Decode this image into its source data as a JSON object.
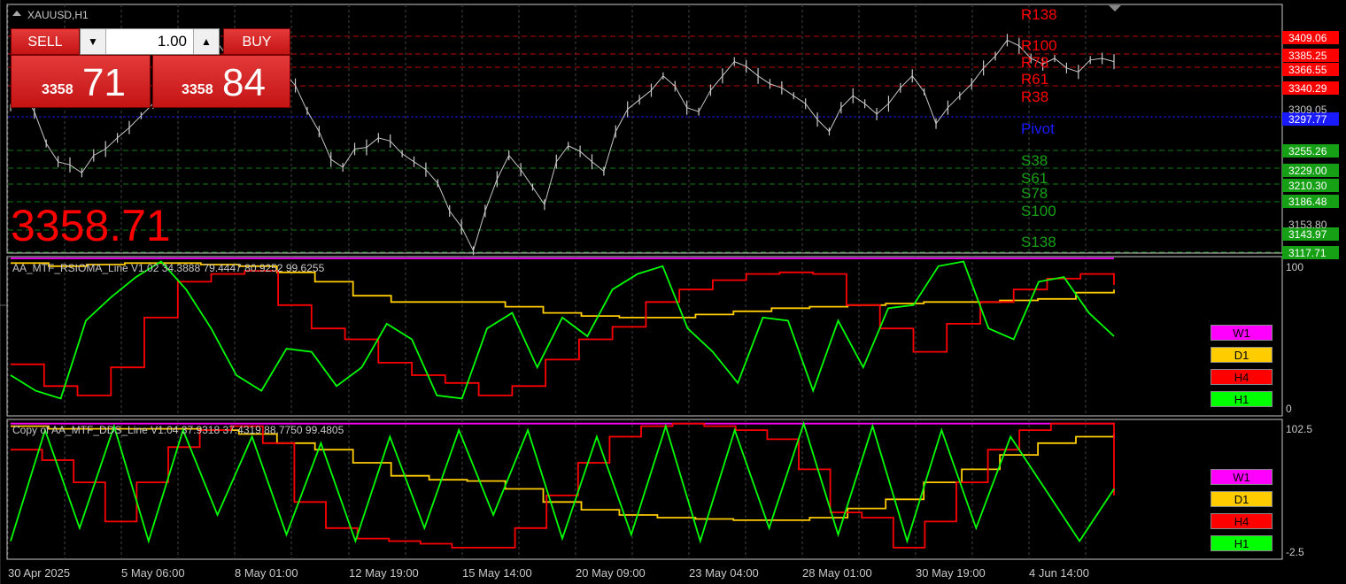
{
  "symbol_title": "XAUUSD,H1",
  "trade_panel": {
    "sell_label": "SELL",
    "buy_label": "BUY",
    "lot_value": "1.00",
    "sell_big": "3358",
    "sell_small": "71",
    "buy_big": "3358",
    "buy_small": "84"
  },
  "current_price": "3358.71",
  "indicator1_label": "AA_MTF_RSIOMA_Line V1.02 34.3888 79.4447 80.9252 99.6255",
  "indicator2_label": "Copy of AA_MTF_DDS_Line V1.04 37.9318 37.4319 88.7750 99.4805",
  "main_axis_labels": [
    "3309.05",
    "3153.80"
  ],
  "ind1_axis_labels": [
    "100",
    "0"
  ],
  "ind2_axis_labels": [
    "102.5",
    "-2.5"
  ],
  "time_labels": [
    "30 Apr 2025",
    "5 May 06:00",
    "8 May 01:00",
    "12 May 19:00",
    "15 May 14:00",
    "20 May 09:00",
    "23 May 04:00",
    "28 May 01:00",
    "30 May 19:00",
    "4 Jun 14:00"
  ],
  "pivot_levels": [
    {
      "name": "R138",
      "value": "",
      "color": "#ff0000"
    },
    {
      "name": "R100",
      "value": "3409.06",
      "color": "#ff0000"
    },
    {
      "name": "R78",
      "value": "3385.25",
      "color": "#ff0000"
    },
    {
      "name": "R61",
      "value": "3366.55",
      "color": "#ff0000"
    },
    {
      "name": "R38",
      "value": "3340.29",
      "color": "#ff0000"
    },
    {
      "name": "Pivot",
      "value": "3297.77",
      "color": "#1a1aff"
    },
    {
      "name": "S38",
      "value": "3255.26",
      "color": "#16a016"
    },
    {
      "name": "S61",
      "value": "3229.00",
      "color": "#16a016"
    },
    {
      "name": "S78",
      "value": "3210.30",
      "color": "#16a016"
    },
    {
      "name": "S100",
      "value": "3186.48",
      "color": "#16a016"
    },
    {
      "name": "S138",
      "value": "3143.97",
      "color": "#16a016"
    },
    {
      "name": "",
      "value": "3117.71",
      "color": "#16a016"
    }
  ],
  "timeframe_buttons": [
    {
      "label": "W1",
      "color": "#ff00ff"
    },
    {
      "label": "D1",
      "color": "#ffcc00"
    },
    {
      "label": "H4",
      "color": "#ff0000"
    },
    {
      "label": "H1",
      "color": "#00ff00"
    }
  ],
  "chart_data": [
    {
      "type": "line",
      "title": "XAUUSD,H1",
      "series": [
        {
          "values": [
            3300,
            3320,
            3295,
            3255,
            3232,
            3228,
            3218,
            3240,
            3248,
            3262,
            3275,
            3290,
            3305,
            3330,
            3358,
            3370,
            3375,
            3390,
            3370,
            3345,
            3325,
            3318,
            3310,
            3345,
            3328,
            3296,
            3270,
            3235,
            3225,
            3248,
            3250,
            3262,
            3258,
            3242,
            3232,
            3222,
            3205,
            3170,
            3150,
            3120,
            3170,
            3210,
            3240,
            3222,
            3200,
            3178,
            3232,
            3252,
            3245,
            3232,
            3220,
            3270,
            3298,
            3310,
            3322,
            3340,
            3327,
            3300,
            3295,
            3322,
            3340,
            3358,
            3352,
            3340,
            3330,
            3325,
            3315,
            3305,
            3285,
            3270,
            3300,
            3315,
            3305,
            3292,
            3305,
            3325,
            3340,
            3320,
            3280,
            3300,
            3315,
            3330,
            3350,
            3365,
            3385,
            3378,
            3362,
            3355,
            3362,
            3350,
            3345,
            3360,
            3362,
            3358
          ]
        }
      ],
      "ylim": [
        3117,
        3430
      ]
    },
    {
      "type": "line",
      "title": "AA_MTF_RSIOMA_Line V1.02 34.3888 79.4447 80.9252 99.6255",
      "ylim": [
        0,
        100
      ],
      "series": [
        {
          "name": "W1",
          "color": "#ff00ff",
          "values": [
            100,
            100,
            100,
            100,
            100,
            100,
            100,
            100,
            100,
            100,
            100,
            100,
            100,
            100,
            100,
            100,
            100,
            100,
            100,
            100,
            100,
            100,
            100,
            100,
            100,
            100,
            100,
            100,
            100,
            100
          ]
        },
        {
          "name": "D1",
          "color": "#ffcc00",
          "values": [
            97,
            95,
            96,
            97,
            97,
            96,
            95,
            91,
            85,
            76,
            72,
            72,
            72,
            69,
            65,
            63,
            62,
            62,
            64,
            66,
            68,
            69,
            70,
            71,
            72,
            72,
            73,
            74,
            78,
            80
          ]
        },
        {
          "name": "H4",
          "color": "#ff0000",
          "values": [
            32,
            18,
            12,
            30,
            62,
            85,
            90,
            92,
            70,
            55,
            48,
            33,
            25,
            20,
            12,
            18,
            35,
            48,
            56,
            72,
            80,
            86,
            90,
            91,
            90,
            70,
            55,
            40,
            58,
            72,
            80,
            87,
            90,
            83
          ]
        },
        {
          "name": "H1",
          "color": "#00ff00",
          "values": [
            25,
            15,
            10,
            60,
            75,
            88,
            98,
            80,
            55,
            25,
            15,
            42,
            40,
            18,
            30,
            58,
            48,
            12,
            10,
            55,
            65,
            30,
            62,
            50,
            80,
            90,
            95,
            55,
            40,
            20,
            62,
            60,
            15,
            60,
            30,
            68,
            70,
            95,
            98,
            55,
            48,
            85,
            88,
            65,
            50
          ]
        }
      ]
    },
    {
      "type": "line",
      "title": "Copy of AA_MTF_DDS_Line V1.04 37.9318 37.4319 88.7750 99.4805",
      "ylim": [
        -2.5,
        102.5
      ],
      "series": [
        {
          "name": "W1",
          "color": "#ff00ff",
          "values": [
            100,
            100,
            100,
            100,
            100,
            100,
            100,
            100,
            100,
            100,
            100,
            100,
            100,
            100,
            100,
            100,
            100,
            100,
            100,
            100,
            100,
            100,
            100,
            100,
            100,
            100,
            100,
            100,
            100,
            100
          ]
        },
        {
          "name": "D1",
          "color": "#ffcc00",
          "values": [
            98,
            96,
            96,
            96,
            96,
            95,
            92,
            85,
            80,
            70,
            60,
            57,
            56,
            50,
            40,
            34,
            30,
            28,
            27,
            26,
            26,
            28,
            35,
            42,
            55,
            65,
            76,
            85,
            90,
            92
          ]
        },
        {
          "name": "H4",
          "color": "#ff0000",
          "values": [
            80,
            72,
            55,
            25,
            55,
            82,
            95,
            98,
            85,
            40,
            20,
            12,
            10,
            8,
            5,
            5,
            20,
            45,
            70,
            90,
            98,
            100,
            98,
            95,
            88,
            65,
            32,
            28,
            5,
            25,
            55,
            80,
            95,
            100,
            100,
            45
          ]
        },
        {
          "name": "H1",
          "color": "#00ff00",
          "values": [
            10,
            95,
            20,
            98,
            10,
            95,
            30,
            90,
            15,
            85,
            10,
            90,
            20,
            95,
            30,
            95,
            12,
            90,
            15,
            98,
            10,
            95,
            20,
            100,
            15,
            98,
            10,
            95,
            20,
            90,
            50,
            10,
            50
          ]
        }
      ]
    }
  ]
}
